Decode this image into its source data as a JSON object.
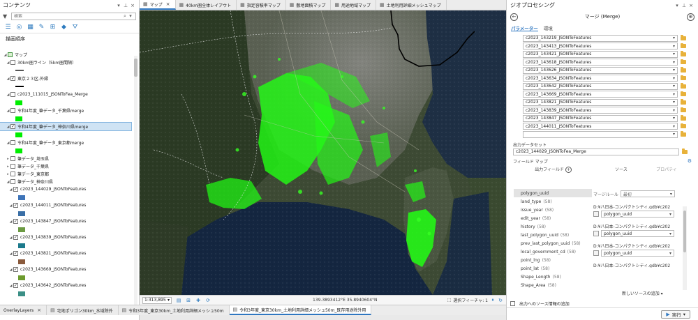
{
  "contents": {
    "title": "コンテンツ",
    "search_placeholder": "検索",
    "section_label": "描画順序",
    "tree": [
      {
        "label": "マップ",
        "checked": null,
        "indent": 0,
        "icon": "map-icon"
      },
      {
        "label": "30km圏ライン（5km圏間隔）",
        "checked": false,
        "indent": 1,
        "swatch": {
          "color": "#ffffff",
          "line": true,
          "border": "#555"
        }
      },
      {
        "label": "東京２３区-外縁",
        "checked": true,
        "indent": 1,
        "swatch": {
          "color": "#000000",
          "line": true
        }
      },
      {
        "label": "c2023_111015_JSONToFea_Merge",
        "checked": false,
        "indent": 1,
        "swatch": {
          "color": "#00ee00"
        }
      },
      {
        "label": "令和4年度_筆データ_千葉県merge",
        "checked": false,
        "indent": 1,
        "swatch": {
          "color": "#00ee00"
        }
      },
      {
        "label": "令和4年度_筆データ_神奈川県merge",
        "checked": true,
        "indent": 1,
        "selected": true,
        "swatch": {
          "color": "#00ee00"
        }
      },
      {
        "label": "令和4年度_筆データ_東京都merge",
        "checked": false,
        "indent": 1,
        "swatch": {
          "color": "#00ee00"
        }
      },
      {
        "label": "筆データ_埼玉県",
        "checked": false,
        "indent": 1,
        "group": true
      },
      {
        "label": "筆データ_千葉県",
        "checked": false,
        "indent": 1,
        "group": true
      },
      {
        "label": "筆データ_東京都",
        "checked": false,
        "indent": 1,
        "group": true
      },
      {
        "label": "筆データ_神奈川県",
        "checked": false,
        "indent": 1,
        "group": true,
        "open": true
      },
      {
        "label": "c2023_144029_JSONToFeatures",
        "checked": true,
        "indent": 2,
        "swatch": {
          "color": "#3f74b8"
        }
      },
      {
        "label": "c2023_144011_JSONToFeatures",
        "checked": true,
        "indent": 2,
        "swatch": {
          "color": "#3a6fa6"
        }
      },
      {
        "label": "c2023_143847_JSONToFeatures",
        "checked": true,
        "indent": 2,
        "swatch": {
          "color": "#6c9a43"
        }
      },
      {
        "label": "c2023_143839_JSONToFeatures",
        "checked": true,
        "indent": 2,
        "swatch": {
          "color": "#1c7a8c"
        }
      },
      {
        "label": "c2023_143821_JSONToFeatures",
        "checked": true,
        "indent": 2,
        "swatch": {
          "color": "#8a5a3c"
        }
      },
      {
        "label": "c2023_143669_JSONToFeatures",
        "checked": true,
        "indent": 2,
        "swatch": {
          "color": "#6d9b2e"
        }
      },
      {
        "label": "c2023_143642_JSONToFeatures",
        "checked": true,
        "indent": 2,
        "swatch": {
          "color": "#3b8f86"
        }
      }
    ]
  },
  "map": {
    "tabs": [
      {
        "label": "マップ",
        "active": true
      },
      {
        "label": "40km圏全体レイアウト"
      },
      {
        "label": "指定容積率マップ"
      },
      {
        "label": "敷地面積マップ"
      },
      {
        "label": "用途地域マップ"
      },
      {
        "label": "土地利用詳細メッシュマップ"
      }
    ],
    "scale": "1:313,895",
    "coords": "139.3893412°E 35.8940604°N",
    "selected_features": "選択フィーチャ: 1",
    "bottom_tabs": [
      "OverlayLayers",
      "宅地ポリゴン30km_水域除外",
      "令和3年度_東京30km_土地利用詳細メッシュ50m",
      "令和3年度_東京30km_土地利用詳細メッシュ50m_既存用途除外用"
    ]
  },
  "geoprocessing": {
    "title": "ジオプロセシング",
    "tool_name": "マージ (Merge)",
    "tabs": [
      "パラメーター",
      "環境"
    ],
    "input_datasets": [
      "c2023_143219_JSONToFeatures",
      "c2023_143413_JSONToFeatures",
      "c2023_143421_JSONToFeatures",
      "c2023_143618_JSONToFeatures",
      "c2023_143626_JSONToFeatures",
      "c2023_143634_JSONToFeatures",
      "c2023_143642_JSONToFeatures",
      "c2023_143669_JSONToFeatures",
      "c2023_143821_JSONToFeatures",
      "c2023_143839_JSONToFeatures",
      "c2023_143847_JSONToFeatures",
      "c2023_144011_JSONToFeatures",
      ""
    ],
    "output_label": "出力データセット",
    "output_value": "c2023_144029_JSONToFea_Merge",
    "field_map_label": "フィールド マップ",
    "col_output": "出力フィールド",
    "col_source": "ソース",
    "col_property": "プロパティ",
    "merge_rule_label": "マージルール",
    "merge_rule_value": "最初",
    "fields": [
      {
        "name": "polygon_uuid",
        "count": ""
      },
      {
        "name": "land_type",
        "count": "(58)"
      },
      {
        "name": "issue_year",
        "count": "(58)"
      },
      {
        "name": "edit_year",
        "count": "(58)"
      },
      {
        "name": "history",
        "count": "(58)"
      },
      {
        "name": "last_polygon_uuid",
        "count": "(58)"
      },
      {
        "name": "prev_last_polygon_uuid",
        "count": "(58)"
      },
      {
        "name": "local_government_cd",
        "count": "(58)"
      },
      {
        "name": "point_lng",
        "count": "(58)"
      },
      {
        "name": "point_lat",
        "count": "(58)"
      },
      {
        "name": "Shape_Length",
        "count": "(58)"
      },
      {
        "name": "Shape_Area",
        "count": "(58)"
      }
    ],
    "sources": [
      {
        "path": "D:¥八日本-コンパクトシティ.gdb¥c2023_144",
        "field": "polygon_uuid"
      },
      {
        "path": "D:¥八日本-コンパクトシティ.gdb¥c2023_141",
        "field": "polygon_uuid"
      },
      {
        "path": "D:¥八日本-コンパクトシティ.gdb¥c2023_141",
        "field": "polygon_uuid"
      },
      {
        "path": "D:¥八日本-コンパクトシティ.gdb¥c2023_141",
        "field": ""
      }
    ],
    "add_source": "新しいソースの追加",
    "footer_check": "出力へのソース情報の追加",
    "run_label": "実行"
  }
}
